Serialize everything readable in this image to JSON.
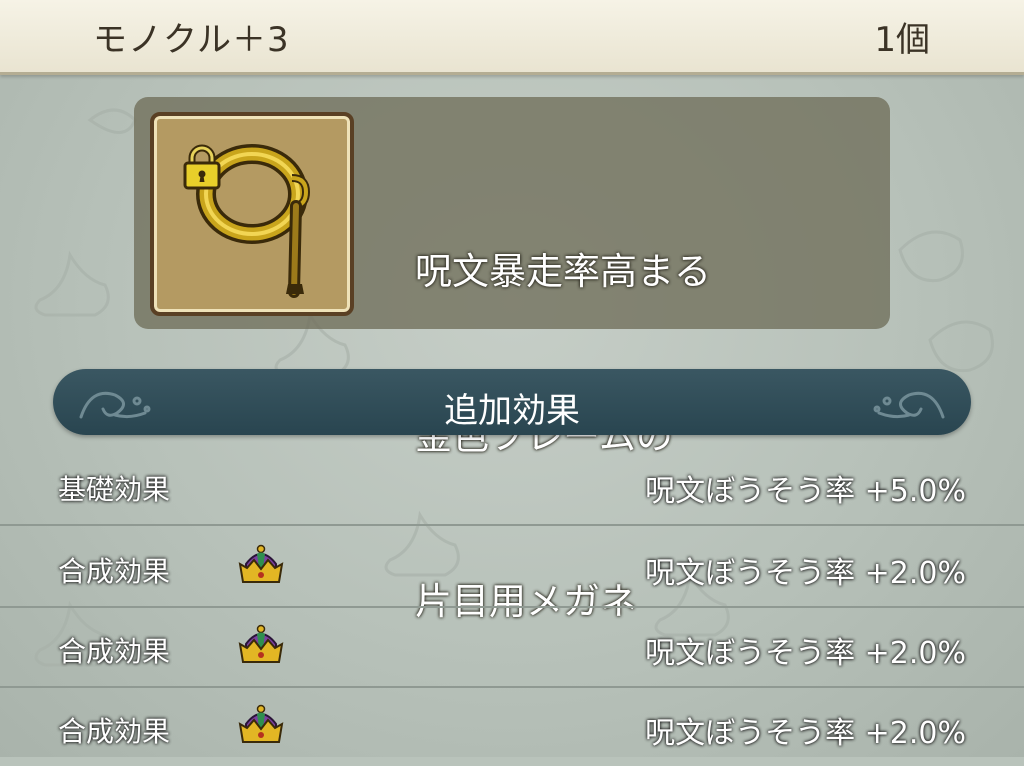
{
  "header": {
    "item_name": "モノクル＋3",
    "count": "1個"
  },
  "item": {
    "icon": "monocle-icon",
    "locked": true,
    "description": [
      "呪文暴走率高まる",
      "金色フレームの",
      "片目用メガネ"
    ]
  },
  "effects": {
    "title": "追加効果",
    "rows": [
      {
        "label": "基礎効果",
        "crown": false,
        "stat": "呪文ぼうそう率  +5.0%"
      },
      {
        "label": "合成効果",
        "crown": true,
        "stat": "呪文ぼうそう率  +2.0%"
      },
      {
        "label": "合成効果",
        "crown": true,
        "stat": "呪文ぼうそう率  +2.0%"
      },
      {
        "label": "合成効果",
        "crown": true,
        "stat": "呪文ぼうそう率  +2.0%"
      }
    ]
  },
  "colors": {
    "header_bg": "#f2efe0",
    "panel_bg": "#706e5a",
    "title_bar": "#2f4d58",
    "crown_gold": "#e2b624",
    "crown_purple": "#7a3fa0"
  }
}
